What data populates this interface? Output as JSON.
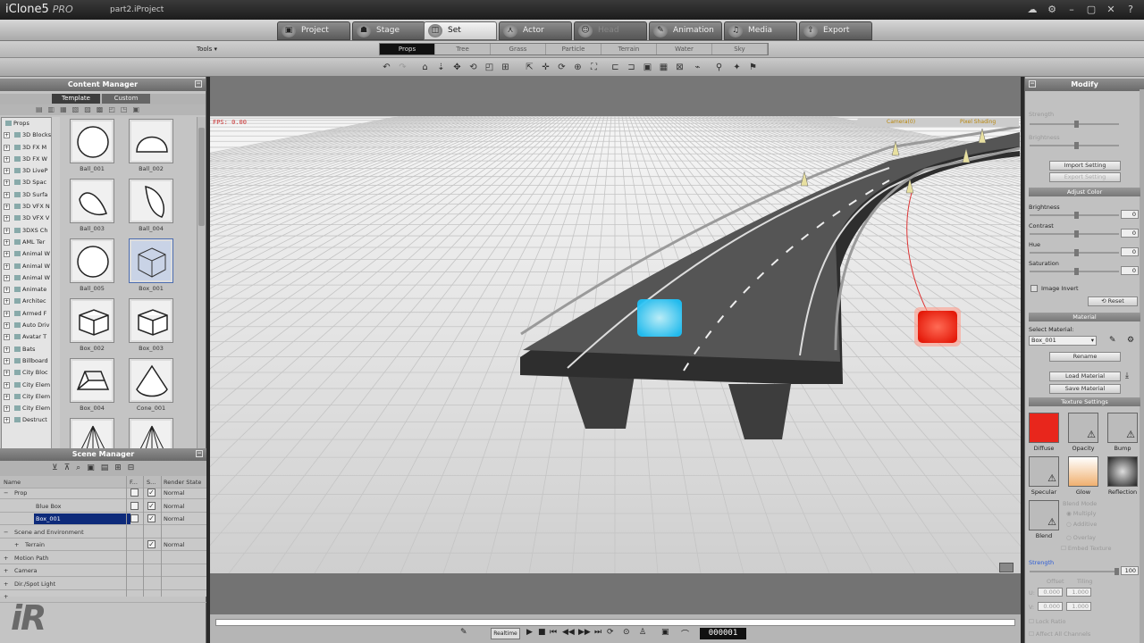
{
  "app": {
    "name": "iClone5",
    "edition": "PRO",
    "project": "part2.iProject"
  },
  "tabs": [
    {
      "label": "Project",
      "icon": "project-icon"
    },
    {
      "label": "Stage",
      "icon": "stage-icon"
    },
    {
      "label": "Set",
      "icon": "set-icon",
      "active": true
    },
    {
      "label": "Actor",
      "icon": "actor-icon"
    },
    {
      "label": "Head",
      "icon": "head-icon",
      "disabled": true
    },
    {
      "label": "Animation",
      "icon": "animation-icon"
    },
    {
      "label": "Media",
      "icon": "media-icon"
    },
    {
      "label": "Export",
      "icon": "export-icon"
    }
  ],
  "subbar": {
    "tools_label": "Tools ▾",
    "subtabs": [
      "Props",
      "Tree",
      "Grass",
      "Particle",
      "Terrain",
      "Water",
      "Sky"
    ],
    "active": "Props"
  },
  "content_manager": {
    "title": "Content Manager",
    "tabs": [
      "Template",
      "Custom"
    ],
    "tree": [
      "Props",
      "3D Blocks",
      "3D FX M",
      "3D FX W",
      "3D LiveP",
      "3D Spac",
      "3D Surfa",
      "3D VFX N",
      "3D VFX V",
      "3DXS Ch",
      "AML Ter",
      "Animal W",
      "Animal W",
      "Animal W",
      "Animate",
      "Architec",
      "Armed F",
      "Auto Driv",
      "Avatar T",
      "Bats",
      "Billboard",
      "City Bloc",
      "City Elem",
      "City Elem",
      "City Elem",
      "Destruct"
    ],
    "thumbs": [
      "Ball_001",
      "Ball_002",
      "Ball_003",
      "Ball_004",
      "Ball_005",
      "Box_001",
      "Box_002",
      "Box_003",
      "Box_004",
      "Cone_001"
    ]
  },
  "scene_manager": {
    "title": "Scene Manager",
    "columns": [
      "Name",
      "F...",
      "S...",
      "Render State"
    ],
    "rows": [
      {
        "name": "Prop",
        "exp": "−",
        "f": false,
        "s": true,
        "rs": "Normal"
      },
      {
        "name": "Blue Box",
        "f": false,
        "s": true,
        "rs": "Normal"
      },
      {
        "name": "Box_001",
        "f": false,
        "s": true,
        "rs": "Normal",
        "selected": true
      },
      {
        "name": "Scene and Environment",
        "exp": "−"
      },
      {
        "name": "Terrain",
        "exp": "+",
        "s": true,
        "rs": "Normal"
      },
      {
        "name": "Motion Path",
        "exp": "+"
      },
      {
        "name": "Camera",
        "exp": "+"
      },
      {
        "name": "Dir./Spot Light",
        "exp": "+"
      },
      {
        "name": "",
        "exp": "+"
      }
    ]
  },
  "viewport": {
    "fps": "FPS: 0.00",
    "camera": "Camera(0)",
    "shading": "Pixel Shading"
  },
  "timeline": {
    "realtime": "Realtime",
    "frame": "000001"
  },
  "modify": {
    "title": "Modify",
    "dim_labels": [
      "Strength",
      "Brightness"
    ],
    "import_setting": "Import Setting",
    "export_setting": "Export Setting",
    "adjust_color": "Adjust Color",
    "color_rows": [
      {
        "label": "Brightness",
        "value": "0"
      },
      {
        "label": "Contrast",
        "value": "0"
      },
      {
        "label": "Hue",
        "value": "0"
      },
      {
        "label": "Saturation",
        "value": "0"
      }
    ],
    "image_invert": "Image Invert",
    "reset": "Reset",
    "material": "Material",
    "select_material": "Select Material:",
    "material_value": "Box_001",
    "rename": "Rename",
    "load_material": "Load Material",
    "save_material": "Save Material",
    "texture_settings": "Texture Settings",
    "textures": [
      "Diffuse",
      "Opacity",
      "Bump",
      "Specular",
      "Glow",
      "Reflection",
      "Blend"
    ],
    "blend_mode": "Blend Mode",
    "blend_options": [
      "Multiply",
      "Additive",
      "Overlay"
    ],
    "embed_texture": "Embed Texture",
    "strength_label": "Strength",
    "strength_value": "100",
    "offset": "Offset",
    "tiling": "Tiling",
    "u_offset": "0.000",
    "u_tiling": "1.000",
    "v_offset": "0.000",
    "v_tiling": "1.000",
    "lock_ratio": "Lock Ratio",
    "affect_all": "Affect All Channels",
    "colors": {
      "diffuse": "#e8261c",
      "accent": "#2b5bd6"
    }
  },
  "watermark": "iR"
}
